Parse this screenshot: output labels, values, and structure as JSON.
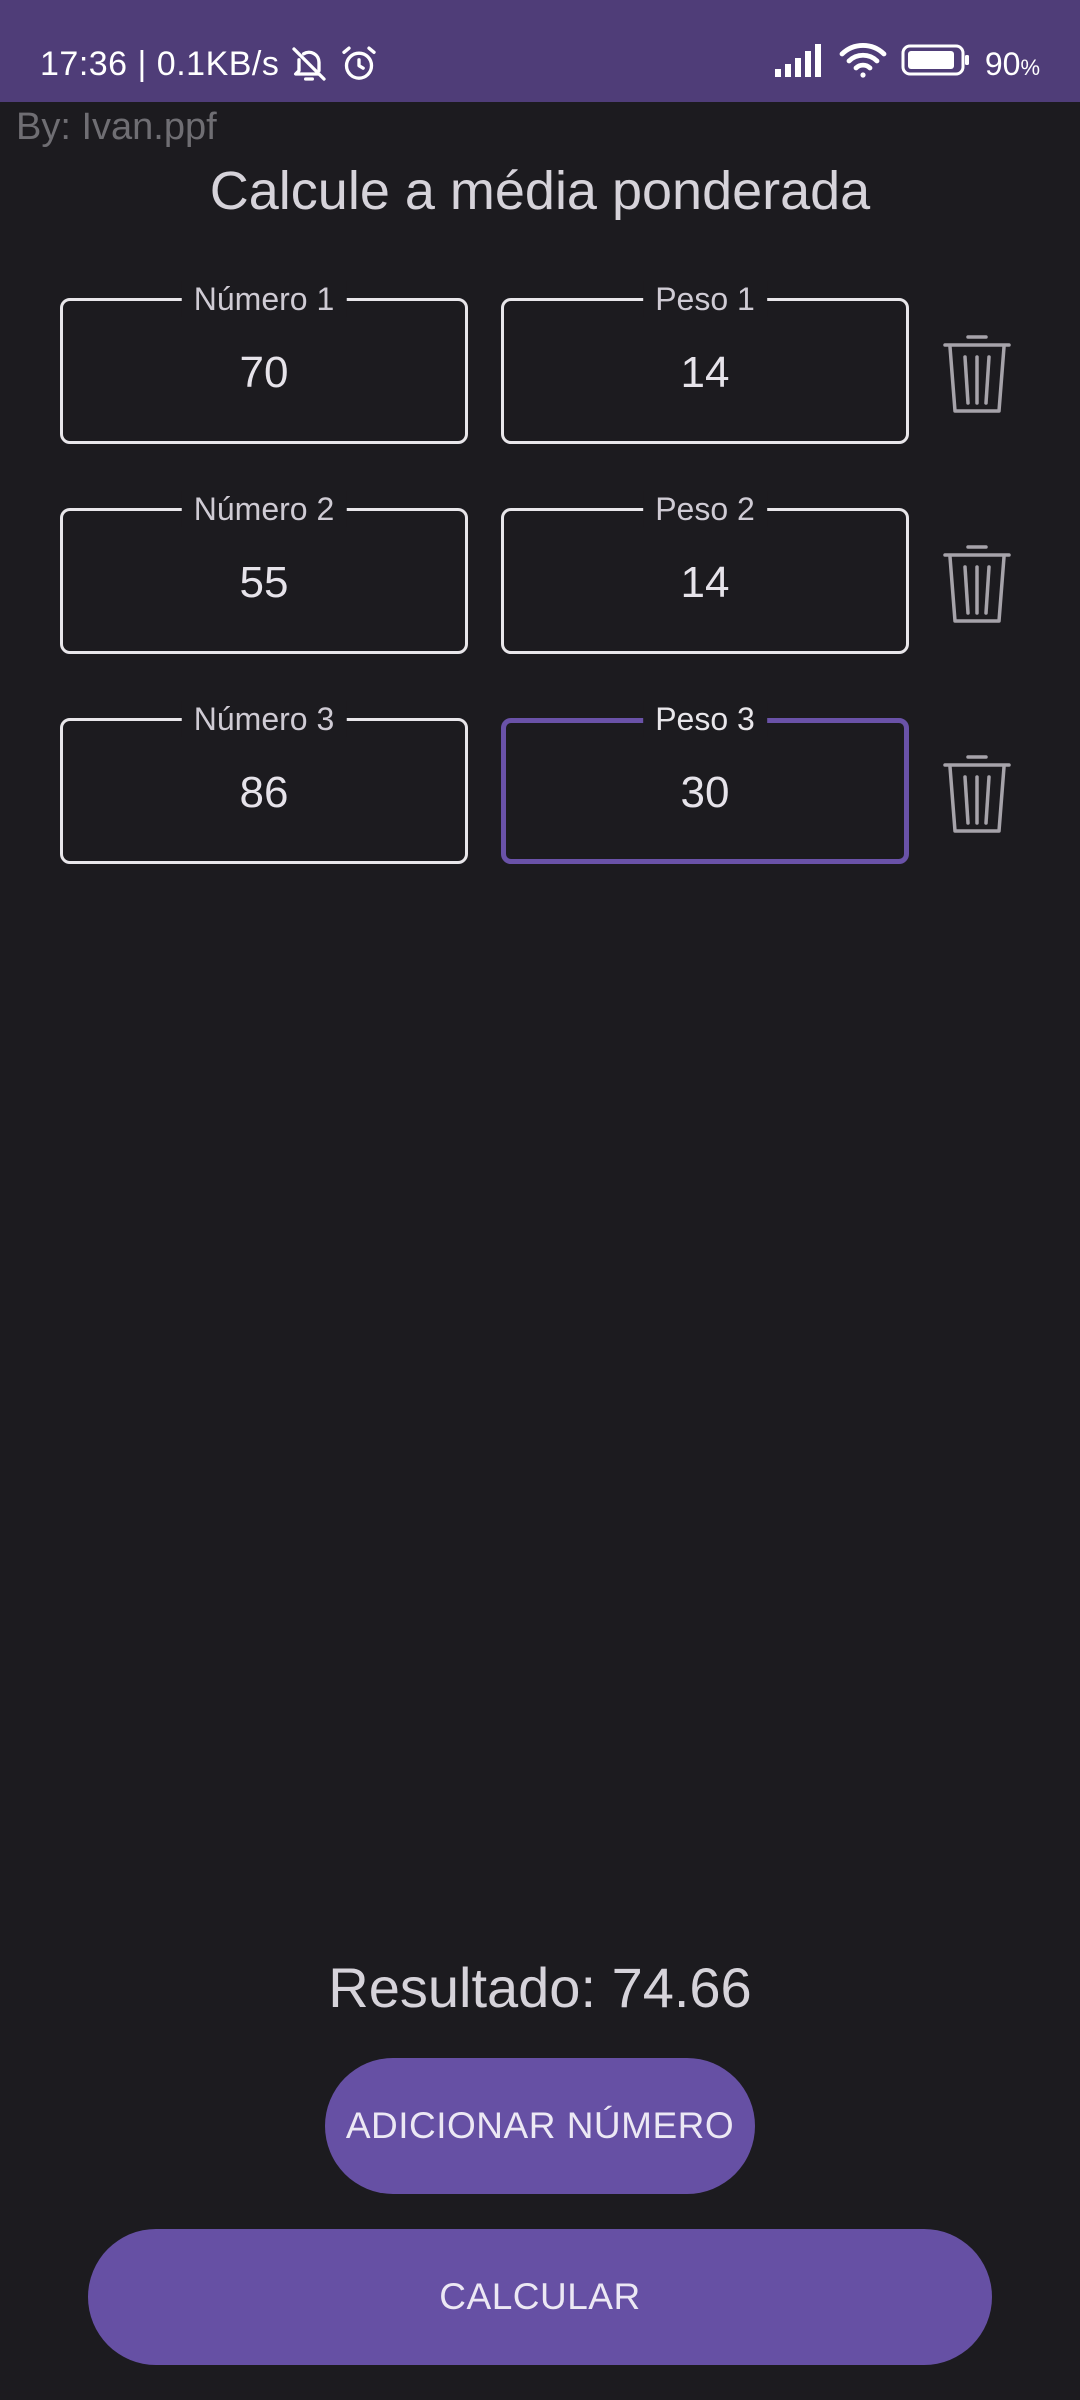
{
  "status_bar": {
    "time_speed": "17:36 | 0.1KB/s",
    "battery_percent": "90",
    "battery_unit": "%",
    "icons": [
      "bell-off-icon",
      "alarm-icon",
      "signal-icon",
      "wifi-icon",
      "battery-icon"
    ],
    "bg_color": "#4f3d78"
  },
  "credit": "By: Ivan.ppf",
  "title": "Calcule a média ponderada",
  "rows": [
    {
      "number_label": "Número 1",
      "number_value": "70",
      "weight_label": "Peso 1",
      "weight_value": "14"
    },
    {
      "number_label": "Número 2",
      "number_value": "55",
      "weight_label": "Peso 2",
      "weight_value": "14"
    },
    {
      "number_label": "Número 3",
      "number_value": "86",
      "weight_label": "Peso 3",
      "weight_value": "30"
    }
  ],
  "focused_field": "Peso 3",
  "result": "Resultado: 74.66",
  "buttons": {
    "add": "ADICIONAR NÚMERO",
    "calculate": "CALCULAR"
  },
  "colors": {
    "background": "#1c1b1f",
    "accent": "#6650a4",
    "focus_border": "#6a52a8"
  }
}
